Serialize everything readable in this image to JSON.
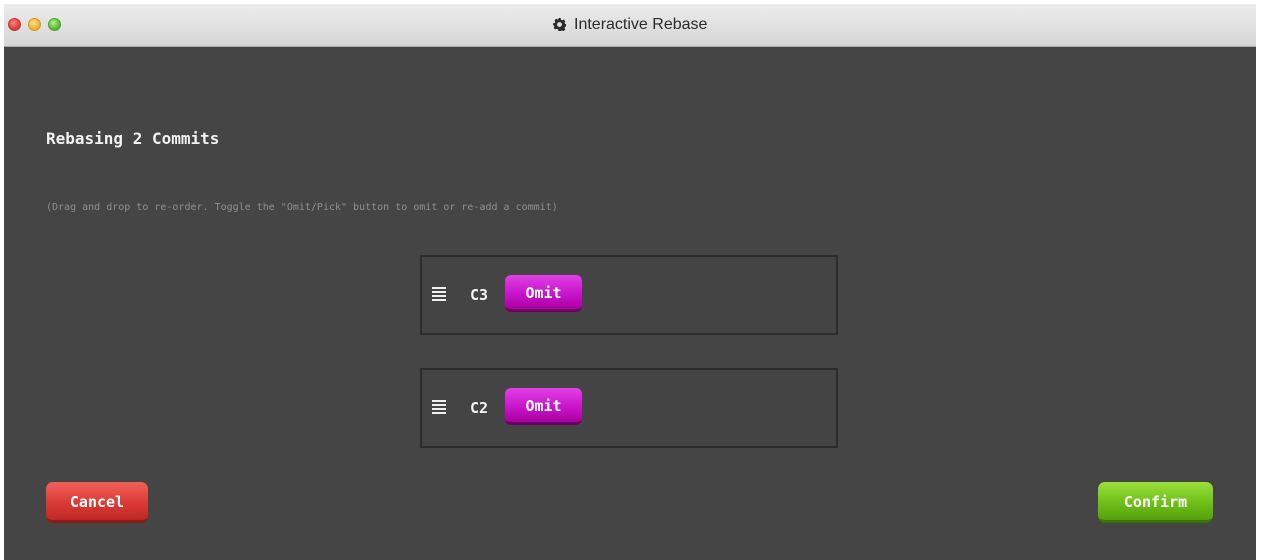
{
  "window": {
    "title": "Interactive Rebase",
    "title_icon": "gear-icon"
  },
  "dialog": {
    "heading": "Rebasing 2 Commits",
    "hint": "(Drag and drop to re-order. Toggle the \"Omit/Pick\" button to omit or re-add a commit)"
  },
  "commits": [
    {
      "id": "C3",
      "toggle_label": "Omit",
      "handle_icon": "drag-handle-icon"
    },
    {
      "id": "C2",
      "toggle_label": "Omit",
      "handle_icon": "drag-handle-icon"
    }
  ],
  "actions": {
    "cancel_label": "Cancel",
    "confirm_label": "Confirm"
  },
  "colors": {
    "background": "#454545",
    "omit_button": "#c914cc",
    "cancel_button": "#dc3a35",
    "confirm_button": "#6fbf19"
  }
}
